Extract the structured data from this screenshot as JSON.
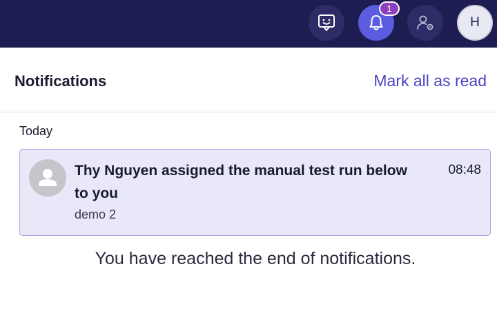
{
  "topbar": {
    "feedback_icon": "chat-smile-icon",
    "bell_icon": "bell-icon",
    "settings_icon": "user-settings-icon",
    "notification_count": "1",
    "avatar_initial": "H",
    "colors": {
      "bar": "#1e1d52",
      "bell_active": "#5b5ce0",
      "badge": "#8e3fbf"
    }
  },
  "panel": {
    "title": "Notifications",
    "mark_all": "Mark all as read"
  },
  "groups": [
    {
      "label": "Today",
      "items": [
        {
          "message": "Thy Nguyen assigned the manual test run below to you",
          "time": "08:48",
          "subtitle": "demo 2",
          "avatar_icon": "user-placeholder-icon"
        }
      ]
    }
  ],
  "end_message": "You have reached the end of notifications."
}
